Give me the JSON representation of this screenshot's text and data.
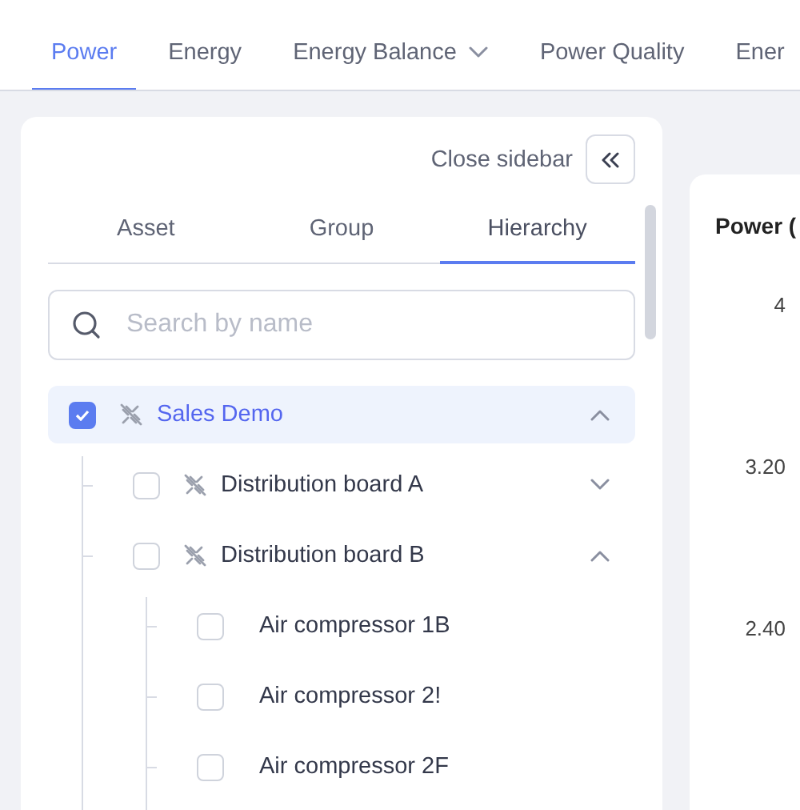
{
  "tabs": [
    {
      "label": "Power",
      "selected": true,
      "dropdown": false
    },
    {
      "label": "Energy",
      "selected": false,
      "dropdown": false
    },
    {
      "label": "Energy Balance",
      "selected": false,
      "dropdown": true
    },
    {
      "label": "Power Quality",
      "selected": false,
      "dropdown": false
    },
    {
      "label": "Ener",
      "selected": false,
      "dropdown": false
    }
  ],
  "sidebar": {
    "close_label": "Close sidebar",
    "tabs": [
      {
        "label": "Asset",
        "selected": false
      },
      {
        "label": "Group",
        "selected": false
      },
      {
        "label": "Hierarchy",
        "selected": true
      }
    ],
    "search": {
      "placeholder": "Search by name"
    },
    "tree": [
      {
        "label": "Sales Demo",
        "kind": "group",
        "checked": true,
        "expanded": true,
        "children": [
          {
            "label": "Distribution board A",
            "kind": "group",
            "checked": false,
            "expanded": false
          },
          {
            "label": "Distribution board B",
            "kind": "group",
            "checked": false,
            "expanded": true,
            "children": [
              {
                "label": "Air compressor 1B",
                "kind": "asset",
                "checked": false
              },
              {
                "label": "Air compressor 2!",
                "kind": "asset",
                "checked": false
              },
              {
                "label": "Air compressor 2F",
                "kind": "asset",
                "checked": false
              }
            ]
          }
        ]
      }
    ]
  },
  "chart": {
    "title": "Power (",
    "y_ticks": [
      "4",
      "3.20",
      "2.40"
    ]
  }
}
